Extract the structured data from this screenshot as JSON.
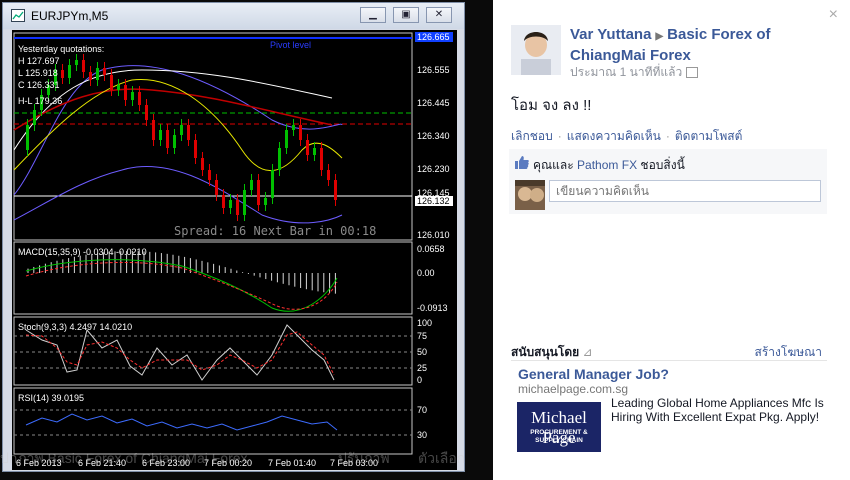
{
  "viewer": {
    "window_title": "EURJPYm,M5",
    "window_buttons": [
      "minimize",
      "maximize",
      "close"
    ],
    "main_chart": {
      "pivot_label": "Pivot level",
      "quotations": [
        "Yesterday quotations:",
        "H 127.697",
        "L 125.918",
        "C 126.331",
        "H-L 179.36"
      ],
      "price_ticks": [
        "126.665",
        "126.555",
        "126.445",
        "126.340",
        "126.230",
        "126.132",
        "126.010"
      ],
      "current_price": "126.132",
      "upper_marker": "126.145",
      "spread_text": "Spread: 16  Next Bar in 00:18"
    },
    "macd": {
      "label": "MACD(15,35,9) -0.0304 -0.0210",
      "ticks": [
        "0.0658",
        "0.00",
        "-0.0913"
      ]
    },
    "stoch": {
      "label": "Stoch(9,3,3) 4.2497 14.0210",
      "ticks": [
        "100",
        "75",
        "50",
        "25",
        "0"
      ]
    },
    "rsi": {
      "label": "RSI(14) 39.0195",
      "ticks": [
        "70",
        "30"
      ]
    },
    "time_axis": [
      "6 Feb 2013",
      "6 Feb 21:40",
      "6 Feb 23:00",
      "7 Feb 00:20",
      "7 Feb 01:40",
      "7 Feb 03:00"
    ],
    "caption_overlay": [
      "ปกภาพ Basic Forex of ChiangMai Forex",
      "ปรับภาพ",
      "ตัวเลือก"
    ]
  },
  "fb": {
    "close_icon": "×",
    "author": "Var Yuttana",
    "page_name": "Basic Forex of ChiangMai Forex",
    "timestamp": "ประมาณ 1 นาทีที่แล้ว",
    "post_text": "โอม จง ลง !!",
    "actions": [
      "เลิกชอบ",
      "แสดงความคิดเห็น",
      "ติดตามโพสต์"
    ],
    "likes_prefix": "คุณและ",
    "likes_name": "Pathom FX",
    "likes_suffix": "ชอบสิ่งนี้",
    "comment_placeholder": "เขียนความคิดเห็น",
    "sponsored_label": "สนับสนุนโดย",
    "create_ad": "สร้างโฆษณา",
    "ad": {
      "title": "General Manager Job?",
      "domain": "michaelpage.com.sg",
      "image_brand": "Michael Page",
      "image_sub": "PROCUREMENT & SUPPLY CHAIN",
      "body": "Leading Global Home Appliances Mfc Is Hiring With Excellent Expat Pkg. Apply!"
    }
  },
  "colors": {
    "fb_blue": "#3b5998",
    "chart_bg": "#000000",
    "candle_up": "#00c000",
    "candle_down": "#e00000"
  }
}
